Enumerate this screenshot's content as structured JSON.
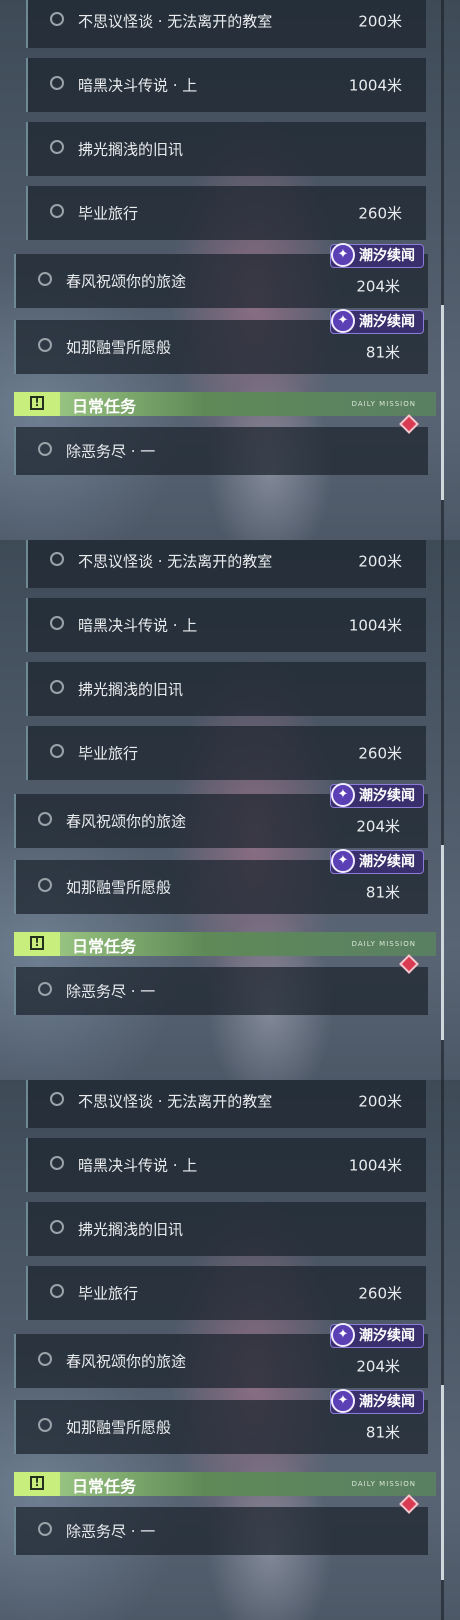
{
  "panels": [
    {
      "quests": [
        {
          "name": "不思议怪谈 · 无法离开的教室",
          "distance": "200米",
          "tag": ""
        },
        {
          "name": "暗黑决斗传说 · 上",
          "distance": "1004米",
          "tag": ""
        },
        {
          "name": "拂光搁浅的旧讯",
          "distance": "",
          "tag": ""
        },
        {
          "name": "毕业旅行",
          "distance": "260米",
          "tag": ""
        },
        {
          "name": "春风祝颂你的旅途",
          "distance": "204米",
          "tag": "潮汐续闻"
        },
        {
          "name": "如那融雪所愿般",
          "distance": "81米",
          "tag": "潮汐续闻"
        }
      ],
      "section_title": "日常任务",
      "section_decor": "DAILY  MISSION",
      "daily": [
        {
          "name": "除恶务尽 · 一"
        }
      ]
    },
    {
      "quests": [
        {
          "name": "不思议怪谈 · 无法离开的教室",
          "distance": "200米",
          "tag": ""
        },
        {
          "name": "暗黑决斗传说 · 上",
          "distance": "1004米",
          "tag": ""
        },
        {
          "name": "拂光搁浅的旧讯",
          "distance": "",
          "tag": ""
        },
        {
          "name": "毕业旅行",
          "distance": "260米",
          "tag": ""
        },
        {
          "name": "春风祝颂你的旅途",
          "distance": "204米",
          "tag": "潮汐续闻"
        },
        {
          "name": "如那融雪所愿般",
          "distance": "81米",
          "tag": "潮汐续闻"
        }
      ],
      "section_title": "日常任务",
      "section_decor": "DAILY  MISSION",
      "daily": [
        {
          "name": "除恶务尽 · 一"
        }
      ]
    },
    {
      "quests": [
        {
          "name": "不思议怪谈 · 无法离开的教室",
          "distance": "200米",
          "tag": ""
        },
        {
          "name": "暗黑决斗传说 · 上",
          "distance": "1004米",
          "tag": ""
        },
        {
          "name": "拂光搁浅的旧讯",
          "distance": "",
          "tag": ""
        },
        {
          "name": "毕业旅行",
          "distance": "260米",
          "tag": ""
        },
        {
          "name": "春风祝颂你的旅途",
          "distance": "204米",
          "tag": "潮汐续闻"
        },
        {
          "name": "如那融雪所愿般",
          "distance": "81米",
          "tag": "潮汐续闻"
        }
      ],
      "section_title": "日常任务",
      "section_decor": "DAILY  MISSION",
      "daily": [
        {
          "name": "除恶务尽 · 一"
        }
      ]
    }
  ],
  "colors": {
    "tag_bg": "#3a2f6d",
    "section_accent": "#c8ee7d",
    "marker": "#d93b52"
  },
  "icons": {
    "tag": "tide-emblem-icon",
    "section": "exclamation-icon",
    "quest": "circle-marker-icon",
    "marker": "diamond-marker-icon"
  }
}
